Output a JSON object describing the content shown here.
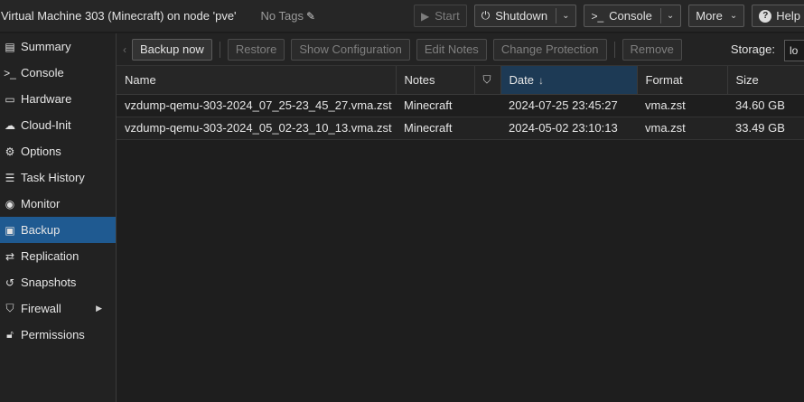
{
  "header": {
    "title": "Virtual Machine 303 (Minecraft) on node 'pve'",
    "tags_label": "No Tags",
    "buttons": {
      "start": "Start",
      "shutdown": "Shutdown",
      "console": "Console",
      "more": "More",
      "help": "Help"
    }
  },
  "sidebar": {
    "items": [
      {
        "label": "Summary",
        "icon": "book-icon"
      },
      {
        "label": "Console",
        "icon": "terminal-icon"
      },
      {
        "label": "Hardware",
        "icon": "desktop-icon"
      },
      {
        "label": "Cloud-Init",
        "icon": "cloud-icon"
      },
      {
        "label": "Options",
        "icon": "gear-icon"
      },
      {
        "label": "Task History",
        "icon": "list-icon"
      },
      {
        "label": "Monitor",
        "icon": "eye-icon"
      },
      {
        "label": "Backup",
        "icon": "floppy-icon",
        "active": true
      },
      {
        "label": "Replication",
        "icon": "retweet-icon"
      },
      {
        "label": "Snapshots",
        "icon": "history-icon"
      },
      {
        "label": "Firewall",
        "icon": "shield-icon",
        "has_submenu": true
      },
      {
        "label": "Permissions",
        "icon": "unlock-icon"
      }
    ]
  },
  "toolbar": {
    "backup_now": "Backup now",
    "restore": "Restore",
    "show_configuration": "Show Configuration",
    "edit_notes": "Edit Notes",
    "change_protection": "Change Protection",
    "remove": "Remove",
    "storage_label": "Storage:",
    "storage_value": "lo"
  },
  "table": {
    "columns": {
      "name": "Name",
      "notes": "Notes",
      "date": "Date",
      "format": "Format",
      "size": "Size"
    },
    "rows": [
      {
        "name": "vzdump-qemu-303-2024_07_25-23_45_27.vma.zst",
        "notes": "Minecraft",
        "date": "2024-07-25 23:45:27",
        "format": "vma.zst",
        "size": "34.60 GB"
      },
      {
        "name": "vzdump-qemu-303-2024_05_02-23_10_13.vma.zst",
        "notes": "Minecraft",
        "date": "2024-05-02 23:10:13",
        "format": "vma.zst",
        "size": "33.49 GB"
      }
    ]
  },
  "colors": {
    "active_item": "#1f5a91",
    "sorted_header": "#1d3a55",
    "background": "#1e1e1e"
  }
}
